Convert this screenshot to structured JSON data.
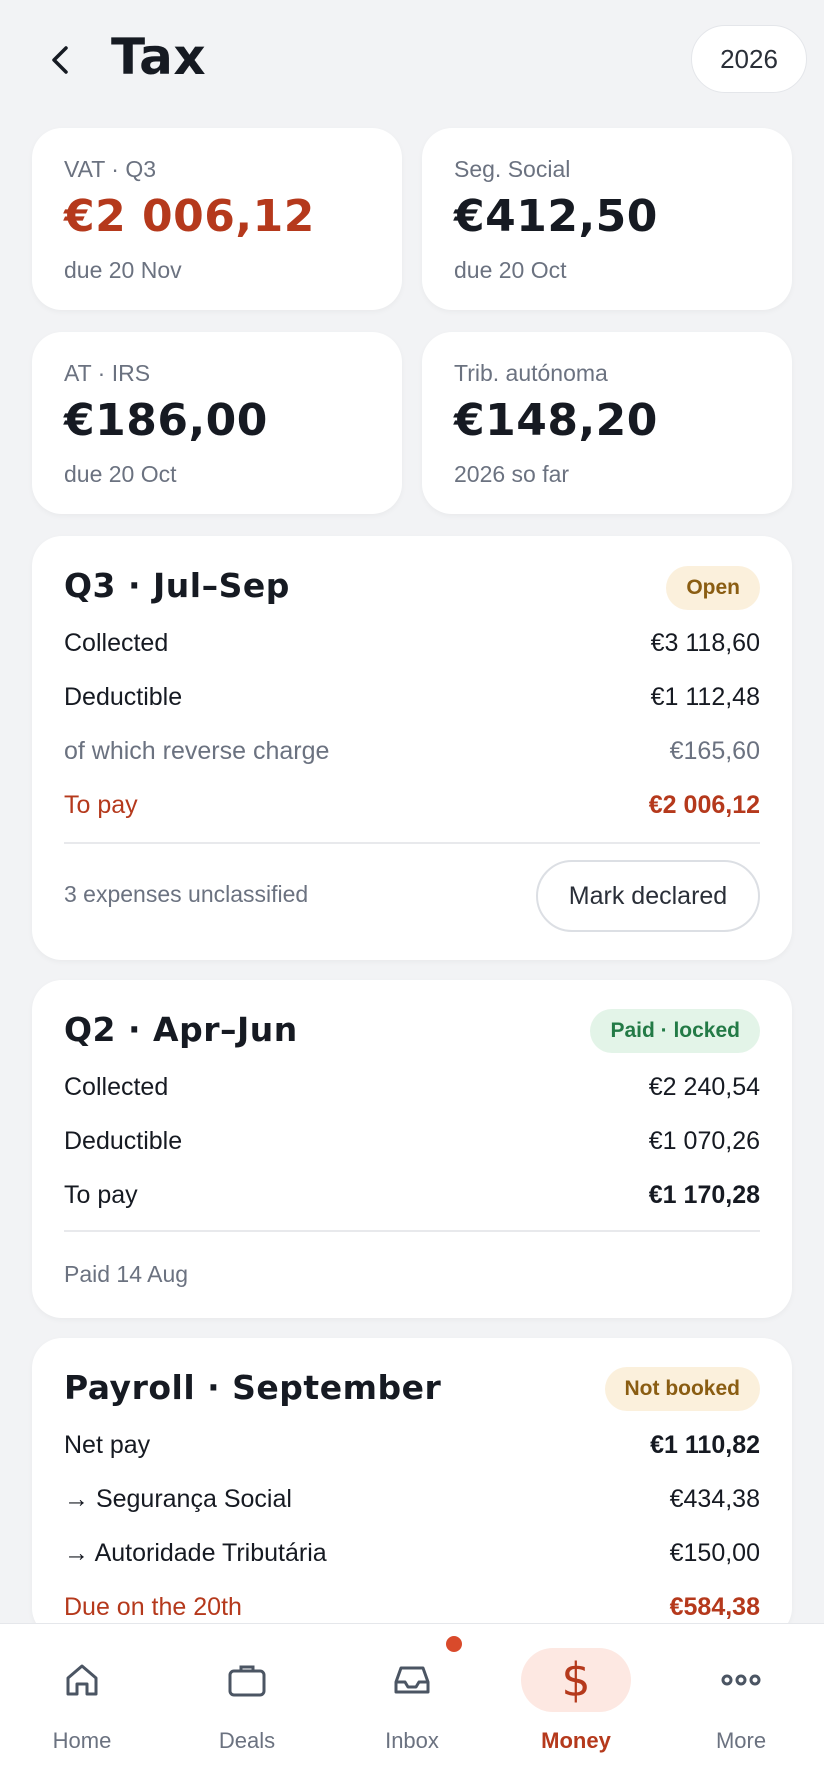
{
  "header": {
    "title": "Tax",
    "year": "2026"
  },
  "stats": [
    {
      "label": "VAT · Q3",
      "value": "€2 006,12",
      "sub": "due 20 Nov"
    },
    {
      "label": "Seg. Social",
      "value": "€412,50",
      "sub": "due 20 Oct"
    },
    {
      "label": "AT · IRS",
      "value": "€186,00",
      "sub": "due 20 Oct"
    },
    {
      "label": "Trib. autónoma",
      "value": "€148,20",
      "sub": "2026 so far"
    }
  ],
  "q3": {
    "title": "Q3 · Jul–Sep",
    "badge": "Open",
    "rows": [
      {
        "label": "Collected",
        "value": "€3 118,60"
      },
      {
        "label": "Deductible",
        "value": "€1 112,48"
      },
      {
        "label": "of which reverse charge",
        "value": "€165,60"
      },
      {
        "label": "To pay",
        "value": "€2 006,12"
      }
    ],
    "footer": "3 expenses unclassified",
    "action": "Mark declared"
  },
  "q2": {
    "title": "Q2 · Apr–Jun",
    "badge": "Paid · locked",
    "rows": [
      {
        "label": "Collected",
        "value": "€2 240,54"
      },
      {
        "label": "Deductible",
        "value": "€1 070,26"
      },
      {
        "label": "To pay",
        "value": "€1 170,28"
      }
    ],
    "footer": "Paid 14 Aug"
  },
  "payroll": {
    "title": "Payroll · September",
    "badge": "Not booked",
    "rows": [
      {
        "label": "Net pay",
        "value": "€1 110,82"
      },
      {
        "label": "→ Segurança Social",
        "value": "€434,38"
      },
      {
        "label": "→ Autoridade Tributária",
        "value": "€150,00"
      },
      {
        "label": "Due on the 20th",
        "value": "€584,38"
      }
    ]
  },
  "nav": {
    "items": [
      {
        "label": "Home",
        "icon": "home-icon"
      },
      {
        "label": "Deals",
        "icon": "briefcase-icon"
      },
      {
        "label": "Inbox",
        "icon": "inbox-icon"
      },
      {
        "label": "Money",
        "icon": "dollar-icon"
      },
      {
        "label": "More",
        "icon": "more-icon"
      }
    ],
    "active": "Money"
  },
  "colors": {
    "accent": "#b5391c",
    "badge_dot": "#d94a2b",
    "paid": "#237a46",
    "warn": "#8a5d12"
  }
}
